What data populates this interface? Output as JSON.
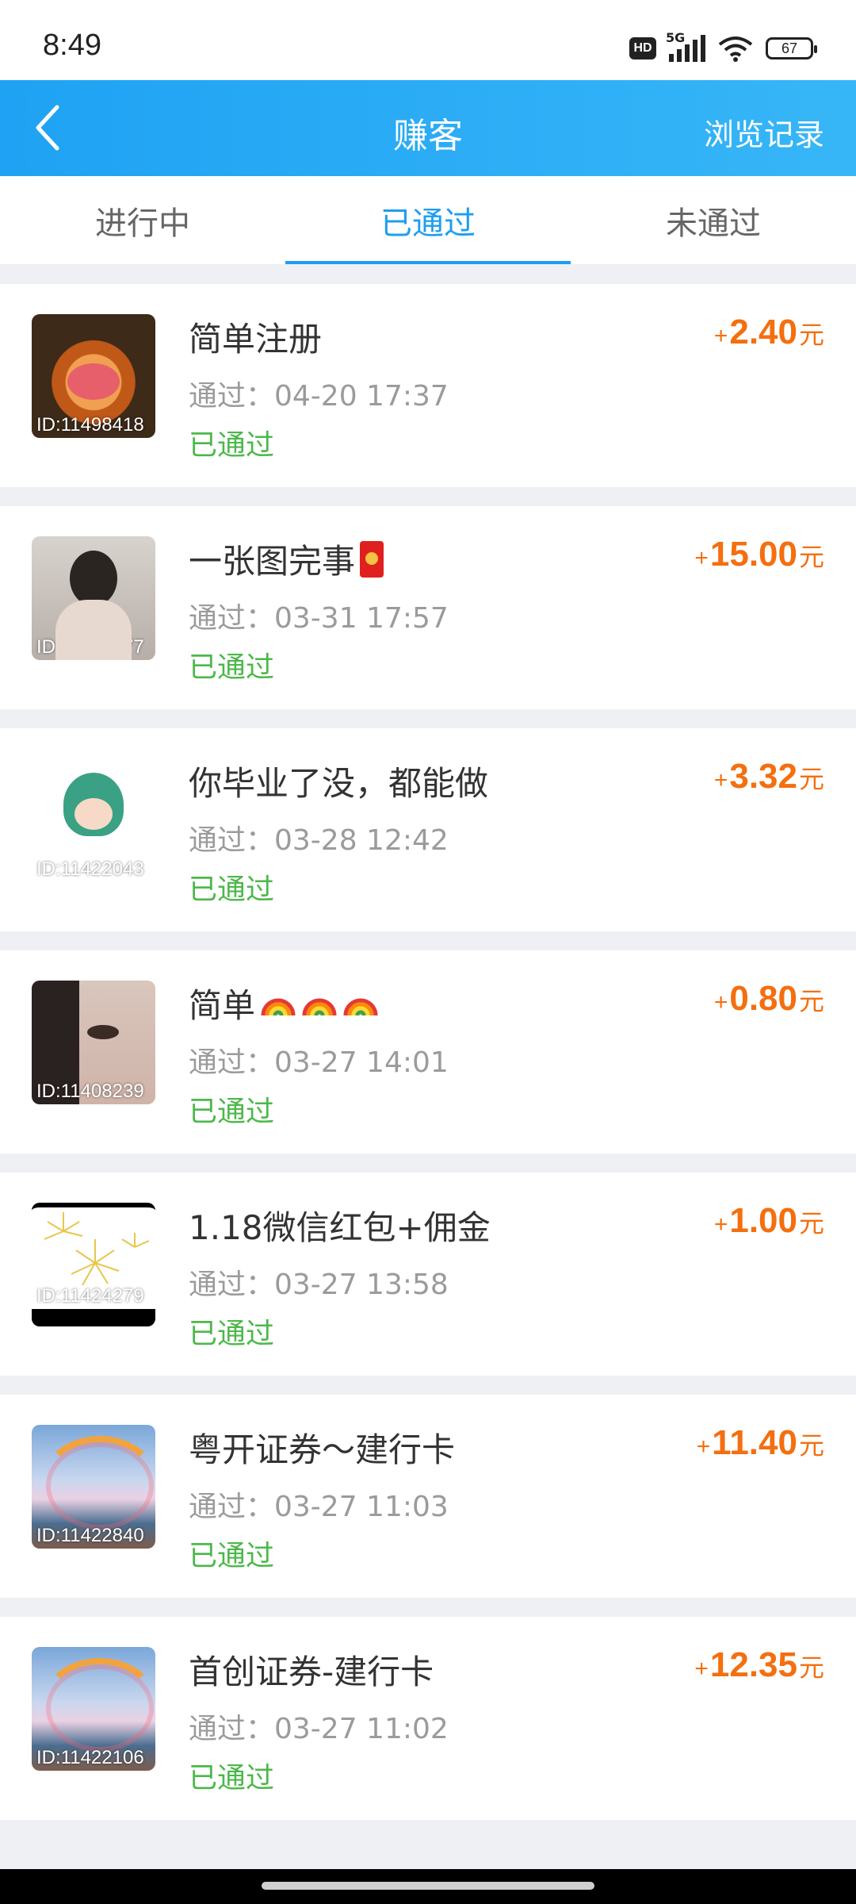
{
  "status_bar": {
    "time": "8:49",
    "hd": "HD",
    "network": "5G",
    "battery": "67"
  },
  "header": {
    "title": "赚客",
    "history_label": "浏览记录",
    "color": "#1fa2f3"
  },
  "tabs": [
    {
      "label": "进行中",
      "active": false
    },
    {
      "label": "已通过",
      "active": true
    },
    {
      "label": "未通过",
      "active": false
    }
  ],
  "items": [
    {
      "title": "简单注册",
      "id": "ID:11498418",
      "time": "通过：04-20 17:37",
      "status": "已通过",
      "plus": "+",
      "amount": "2.40",
      "unit": "元"
    },
    {
      "title": "一张图完事",
      "id": "ID:11307177",
      "time": "通过：03-31 17:57",
      "status": "已通过",
      "plus": "+",
      "amount": "15.00",
      "unit": "元"
    },
    {
      "title": "你毕业了没，都能做",
      "id": "ID:11422043",
      "time": "通过：03-28 12:42",
      "status": "已通过",
      "plus": "+",
      "amount": "3.32",
      "unit": "元"
    },
    {
      "title": "简单",
      "id": "ID:11408239",
      "time": "通过：03-27 14:01",
      "status": "已通过",
      "plus": "+",
      "amount": "0.80",
      "unit": "元"
    },
    {
      "title": "1.18微信红包+佣金",
      "id": "ID:11424279",
      "time": "通过：03-27 13:58",
      "status": "已通过",
      "plus": "+",
      "amount": "1.00",
      "unit": "元"
    },
    {
      "title": "粤开证券～建行卡",
      "id": "ID:11422840",
      "time": "通过：03-27 11:03",
      "status": "已通过",
      "plus": "+",
      "amount": "11.40",
      "unit": "元"
    },
    {
      "title": "首创证券-建行卡",
      "id": "ID:11422106",
      "time": "通过：03-27 11:02",
      "status": "已通过",
      "plus": "+",
      "amount": "12.35",
      "unit": "元"
    }
  ],
  "colors": {
    "amount": "#f46f0f",
    "status": "#4cb84a",
    "tab_active": "#1e9ef0"
  }
}
